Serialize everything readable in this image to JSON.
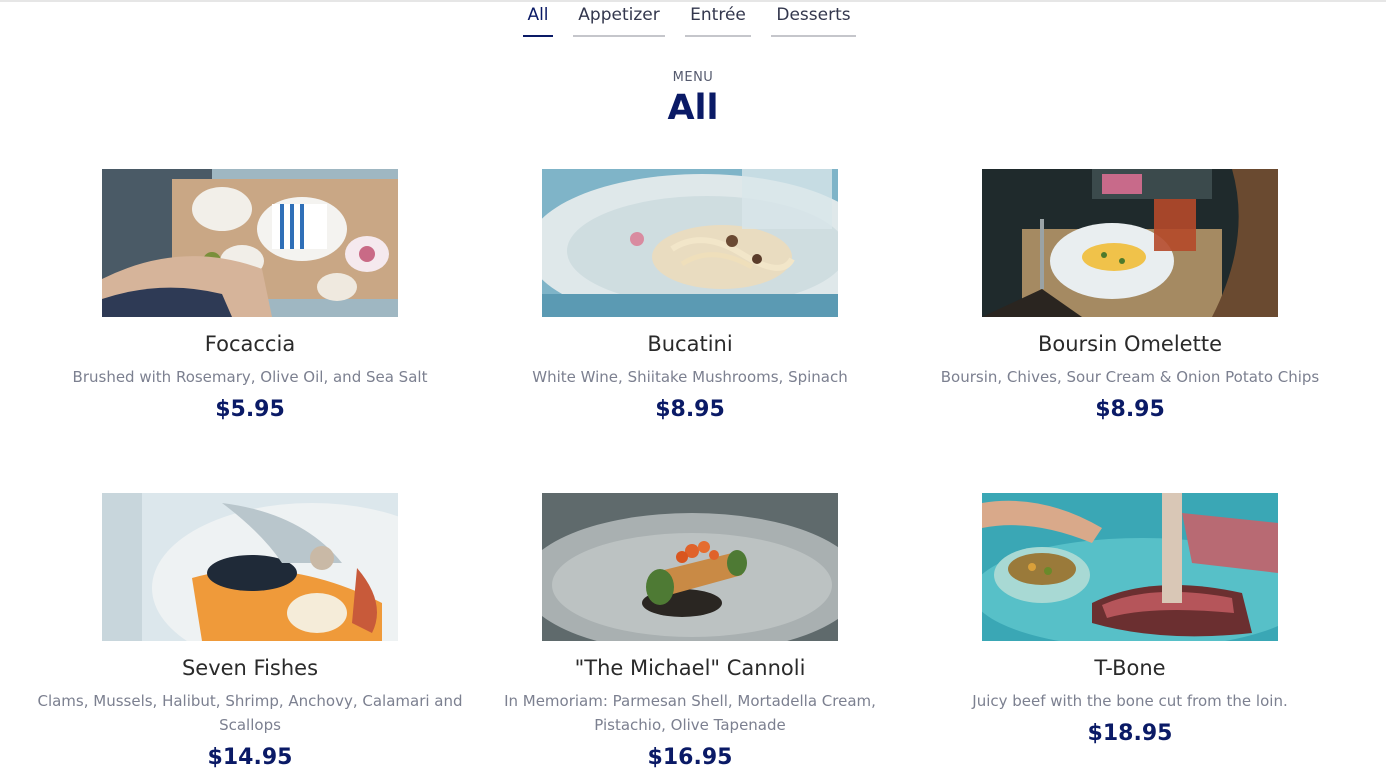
{
  "tabs": [
    {
      "label": "All"
    },
    {
      "label": "Appetizer"
    },
    {
      "label": "Entrée"
    },
    {
      "label": "Desserts"
    }
  ],
  "section": {
    "kicker": "MENU",
    "title": "All"
  },
  "colors": {
    "accent": "#0a1a66",
    "muted": "#7c8090",
    "tab_underline": "#c5c6cb"
  },
  "items": [
    {
      "name": "Focaccia",
      "description": "Brushed with Rosemary, Olive Oil, and Sea Salt",
      "price": "$5.95",
      "image": "focaccia-plates-photo"
    },
    {
      "name": "Bucatini",
      "description": "White Wine, Shiitake Mushrooms, Spinach",
      "price": "$8.95",
      "image": "bucatini-bowl-photo"
    },
    {
      "name": "Boursin Omelette",
      "description": "Boursin, Chives, Sour Cream & Onion Potato Chips",
      "price": "$8.95",
      "image": "omelette-plate-photo"
    },
    {
      "name": "Seven Fishes",
      "description": "Clams, Mussels, Halibut, Shrimp, Anchovy, Calamari and Scallops",
      "price": "$14.95",
      "image": "seafood-plate-photo"
    },
    {
      "name": "\"The Michael\" Cannoli",
      "description": "In Memoriam: Parmesan Shell, Mortadella Cream, Pistachio, Olive Tapenade",
      "price": "$16.95",
      "image": "cannoli-plate-photo"
    },
    {
      "name": "T-Bone",
      "description": "Juicy beef with the bone cut from the loin.",
      "price": "$18.95",
      "image": "tbone-steak-photo"
    }
  ]
}
